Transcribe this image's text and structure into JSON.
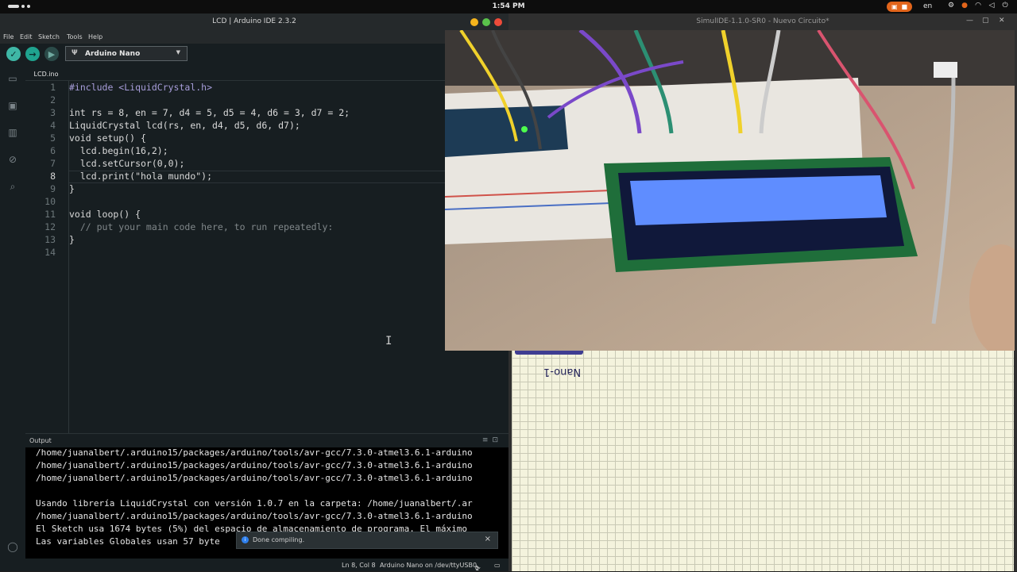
{
  "system": {
    "clock": "1:54 PM",
    "language": "en",
    "tray_icons": [
      "record-icon",
      "settings-icon",
      "mic-icon",
      "wifi-icon",
      "volume-icon",
      "power-icon"
    ]
  },
  "ide": {
    "window_title": "LCD | Arduino IDE 2.3.2",
    "menu": [
      "File",
      "Edit",
      "Sketch",
      "Tools",
      "Help"
    ],
    "board": "Arduino Nano",
    "tab": "LCD.ino",
    "line_numbers": [
      "1",
      "2",
      "3",
      "4",
      "5",
      "6",
      "7",
      "8",
      "9",
      "10",
      "11",
      "12",
      "13",
      "14"
    ],
    "code": [
      "#include <LiquidCrystal.h>",
      "",
      "int rs = 8, en = 7, d4 = 5, d5 = 4, d6 = 3, d7 = 2;",
      "LiquidCrystal lcd(rs, en, d4, d5, d6, d7);",
      "void setup() {",
      "  lcd.begin(16,2);",
      "  lcd.setCursor(0,0);",
      "  lcd.print(\"hola mundo\");",
      "}",
      "",
      "void loop() {",
      "  // put your main code here, to run repeatedly:",
      "}",
      ""
    ],
    "output_title": "Output",
    "output_lines": [
      "/home/juanalbert/.arduino15/packages/arduino/tools/avr-gcc/7.3.0-atmel3.6.1-arduino",
      "/home/juanalbert/.arduino15/packages/arduino/tools/avr-gcc/7.3.0-atmel3.6.1-arduino",
      "/home/juanalbert/.arduino15/packages/arduino/tools/avr-gcc/7.3.0-atmel3.6.1-arduino",
      "",
      "Usando librería LiquidCrystal con versión 1.0.7 en la carpeta: /home/juanalbert/.ar",
      "/home/juanalbert/.arduino15/packages/arduino/tools/avr-gcc/7.3.0-atmel3.6.1-arduino",
      "El Sketch usa 1674 bytes (5%) del espacio de almacenamiento de programa. El máximo",
      "Las variables Globales usan 57 byte"
    ],
    "toast": "Done compiling.",
    "status": {
      "position": "Ln 8, Col 8",
      "board_port": "Arduino Nano on /dev/ttyUSB0",
      "notifications": "1"
    }
  },
  "sim": {
    "window_title": "SimulIDE-1.1.0-SR0 - Nuevo Circuito*",
    "component_label": "Nano-1"
  },
  "colors": {
    "ide_bg": "#171e21",
    "accent": "#1e9fa6",
    "verify_button": "#3fb7a6",
    "upload_button": "#1fa38f",
    "lcd_backlight": "#5f8dff",
    "canvas": "#f4f3dd"
  }
}
